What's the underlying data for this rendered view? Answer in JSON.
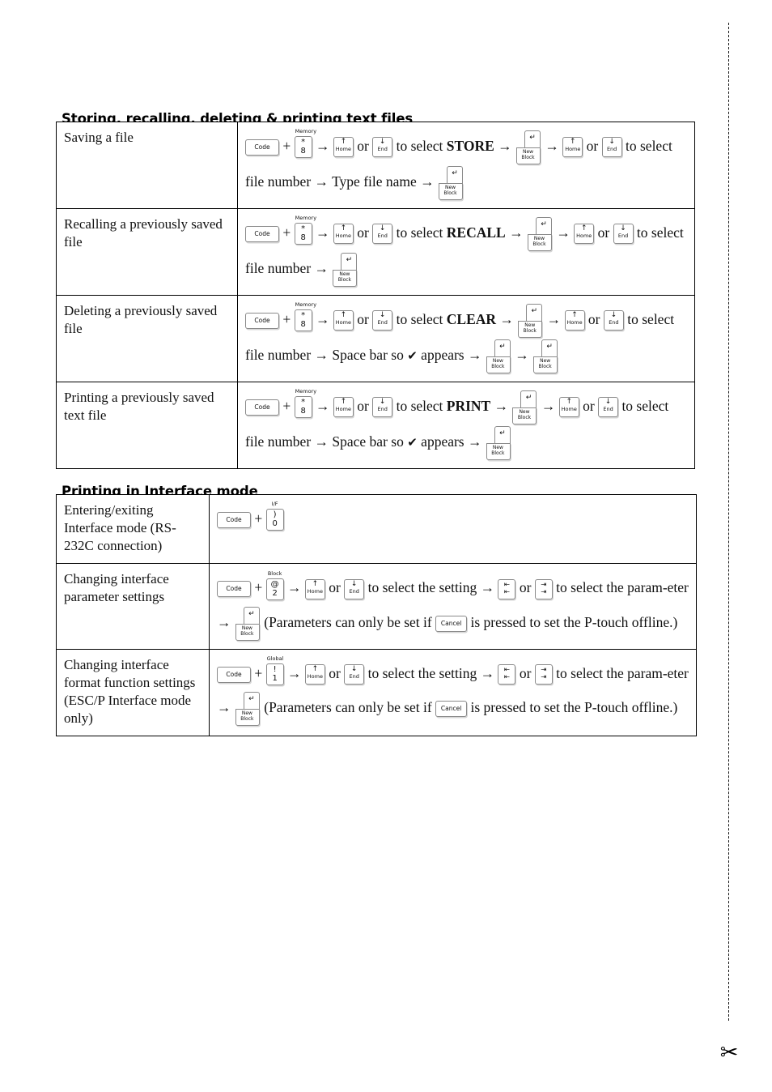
{
  "page": {
    "cut_line": "dashed-cut-line",
    "scissors_icon": "✂"
  },
  "sections": [
    {
      "id": "files",
      "title": "Storing, recalling, deleting & printing text files",
      "rows": [
        {
          "label": "Saving a file",
          "steps": [
            {
              "t": "key-wide",
              "label": "Code"
            },
            {
              "t": "txt",
              "v": " + "
            },
            {
              "t": "key-num",
              "cap": "Memory",
              "upper": "*",
              "lower": "8"
            },
            {
              "t": "txt",
              "v": " → "
            },
            {
              "t": "key-nav",
              "arrow": "↑",
              "label": "Home"
            },
            {
              "t": "txt",
              "v": " or "
            },
            {
              "t": "key-nav",
              "arrow": "↓",
              "label": "End"
            },
            {
              "t": "txt",
              "v": " to select "
            },
            {
              "t": "strong",
              "v": "STORE"
            },
            {
              "t": "txt",
              "v": " → "
            },
            {
              "t": "key-enter",
              "ret": "↵",
              "label": "New Block"
            },
            {
              "t": "txt",
              "v": " → "
            },
            {
              "t": "key-nav",
              "arrow": "↑",
              "label": "Home"
            },
            {
              "t": "txt",
              "v": " or "
            },
            {
              "t": "key-nav",
              "arrow": "↓",
              "label": "End"
            },
            {
              "t": "txt",
              "v": " to select file number → Type file name → "
            },
            {
              "t": "key-enter",
              "ret": "↵",
              "label": "New Block"
            }
          ]
        },
        {
          "label": "Recalling a previously saved file",
          "steps": [
            {
              "t": "key-wide",
              "label": "Code"
            },
            {
              "t": "txt",
              "v": " + "
            },
            {
              "t": "key-num",
              "cap": "Memory",
              "upper": "*",
              "lower": "8"
            },
            {
              "t": "txt",
              "v": " → "
            },
            {
              "t": "key-nav",
              "arrow": "↑",
              "label": "Home"
            },
            {
              "t": "txt",
              "v": " or "
            },
            {
              "t": "key-nav",
              "arrow": "↓",
              "label": "End"
            },
            {
              "t": "txt",
              "v": " to select "
            },
            {
              "t": "strong",
              "v": "RECALL"
            },
            {
              "t": "txt",
              "v": " → "
            },
            {
              "t": "key-enter",
              "ret": "↵",
              "label": "New Block"
            },
            {
              "t": "txt",
              "v": " → "
            },
            {
              "t": "key-nav",
              "arrow": "↑",
              "label": "Home"
            },
            {
              "t": "txt",
              "v": " or "
            },
            {
              "t": "key-nav",
              "arrow": "↓",
              "label": "End"
            },
            {
              "t": "txt",
              "v": " to select file number → "
            },
            {
              "t": "key-enter",
              "ret": "↵",
              "label": "New Block"
            }
          ]
        },
        {
          "label": "Deleting a previously saved file",
          "steps": [
            {
              "t": "key-wide",
              "label": "Code"
            },
            {
              "t": "txt",
              "v": " + "
            },
            {
              "t": "key-num",
              "cap": "Memory",
              "upper": "*",
              "lower": "8"
            },
            {
              "t": "txt",
              "v": " → "
            },
            {
              "t": "key-nav",
              "arrow": "↑",
              "label": "Home"
            },
            {
              "t": "txt",
              "v": " or "
            },
            {
              "t": "key-nav",
              "arrow": "↓",
              "label": "End"
            },
            {
              "t": "txt",
              "v": " to select "
            },
            {
              "t": "strong",
              "v": "CLEAR"
            },
            {
              "t": "txt",
              "v": " → "
            },
            {
              "t": "key-enter",
              "ret": "↵",
              "label": "New Block"
            },
            {
              "t": "txt",
              "v": " → "
            },
            {
              "t": "key-nav",
              "arrow": "↑",
              "label": "Home"
            },
            {
              "t": "txt",
              "v": " or "
            },
            {
              "t": "key-nav",
              "arrow": "↓",
              "label": "End"
            },
            {
              "t": "txt",
              "v": " to select file number → Space bar so "
            },
            {
              "t": "check",
              "v": "✔"
            },
            {
              "t": "txt",
              "v": " appears → "
            },
            {
              "t": "key-enter",
              "ret": "↵",
              "label": "New Block"
            },
            {
              "t": "txt",
              "v": " → "
            },
            {
              "t": "key-enter",
              "ret": "↵",
              "label": "New Block"
            }
          ]
        },
        {
          "label": "Printing a previously saved text file",
          "steps": [
            {
              "t": "key-wide",
              "label": "Code"
            },
            {
              "t": "txt",
              "v": " + "
            },
            {
              "t": "key-num",
              "cap": "Memory",
              "upper": "*",
              "lower": "8"
            },
            {
              "t": "txt",
              "v": " → "
            },
            {
              "t": "key-nav",
              "arrow": "↑",
              "label": "Home"
            },
            {
              "t": "txt",
              "v": " or "
            },
            {
              "t": "key-nav",
              "arrow": "↓",
              "label": "End"
            },
            {
              "t": "txt",
              "v": " to select "
            },
            {
              "t": "strong",
              "v": "PRINT"
            },
            {
              "t": "txt",
              "v": " → "
            },
            {
              "t": "key-enter",
              "ret": "↵",
              "label": "New Block"
            },
            {
              "t": "txt",
              "v": " → "
            },
            {
              "t": "key-nav",
              "arrow": "↑",
              "label": "Home"
            },
            {
              "t": "txt",
              "v": " or "
            },
            {
              "t": "key-nav",
              "arrow": "↓",
              "label": "End"
            },
            {
              "t": "txt",
              "v": " to select file number → Space bar so "
            },
            {
              "t": "check",
              "v": "✔"
            },
            {
              "t": "txt",
              "v": " appears → "
            },
            {
              "t": "key-enter",
              "ret": "↵",
              "label": "New Block"
            }
          ]
        }
      ]
    },
    {
      "id": "interface",
      "title": "Printing in Interface mode",
      "rows": [
        {
          "label": "Entering/exiting Interface mode (RS-232C connection)",
          "steps": [
            {
              "t": "key-wide",
              "label": "Code"
            },
            {
              "t": "txt",
              "v": " + "
            },
            {
              "t": "key-num",
              "cap": "I/F",
              "upper": ")",
              "lower": "0"
            }
          ]
        },
        {
          "label": "Changing interface parameter settings",
          "steps": [
            {
              "t": "key-wide",
              "label": "Code"
            },
            {
              "t": "txt",
              "v": " + "
            },
            {
              "t": "key-num",
              "cap": "Block",
              "upper": "@",
              "lower": "2"
            },
            {
              "t": "txt",
              "v": " → "
            },
            {
              "t": "key-nav",
              "arrow": "↑",
              "label": "Home"
            },
            {
              "t": "txt",
              "v": " or "
            },
            {
              "t": "key-nav",
              "arrow": "↓",
              "label": "End"
            },
            {
              "t": "txt",
              "v": " to select the setting → "
            },
            {
              "t": "key-lr",
              "r1": "⇤",
              "r2": "⇤"
            },
            {
              "t": "txt",
              "v": " or "
            },
            {
              "t": "key-lr",
              "r1": "⇥",
              "r2": "⇥"
            },
            {
              "t": "txt",
              "v": " to select the param-eter → "
            },
            {
              "t": "key-enter",
              "ret": "↵",
              "label": "New Block"
            },
            {
              "t": "txt",
              "v": " (Parameters can only be set if "
            },
            {
              "t": "key-wide-cancel",
              "label": "Cancel"
            },
            {
              "t": "txt",
              "v": " is pressed to set the P-touch offline.)"
            }
          ]
        },
        {
          "label": "Changing interface format function settings (ESC/P Interface mode only)",
          "steps": [
            {
              "t": "key-wide",
              "label": "Code"
            },
            {
              "t": "txt",
              "v": " + "
            },
            {
              "t": "key-num",
              "cap": "Global",
              "upper": "!",
              "lower": "1"
            },
            {
              "t": "txt",
              "v": " → "
            },
            {
              "t": "key-nav",
              "arrow": "↑",
              "label": "Home"
            },
            {
              "t": "txt",
              "v": " or "
            },
            {
              "t": "key-nav",
              "arrow": "↓",
              "label": "End"
            },
            {
              "t": "txt",
              "v": " to select the setting → "
            },
            {
              "t": "key-lr",
              "r1": "⇤",
              "r2": "⇤"
            },
            {
              "t": "txt",
              "v": " or "
            },
            {
              "t": "key-lr",
              "r1": "⇥",
              "r2": "⇥"
            },
            {
              "t": "txt",
              "v": " to select the param-eter → "
            },
            {
              "t": "key-enter",
              "ret": "↵",
              "label": "New Block"
            },
            {
              "t": "txt",
              "v": " (Parameters can only be set if "
            },
            {
              "t": "key-wide-cancel",
              "label": "Cancel"
            },
            {
              "t": "txt",
              "v": " is pressed to set the P-touch offline.)"
            }
          ]
        }
      ]
    }
  ]
}
